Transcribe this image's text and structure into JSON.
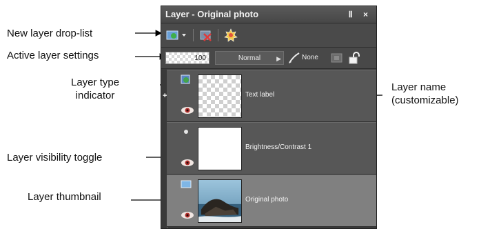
{
  "panel": {
    "title": "Layer - Original photo",
    "window_buttons": "Ⅱ ×",
    "opacity": "100",
    "blend_mode": "Normal",
    "blend_arrow": "▶",
    "brush_mode": "None"
  },
  "layers": [
    {
      "name": "Text label",
      "thumbnail": "transparent-checker"
    },
    {
      "name": "Brightness/Contrast 1",
      "thumbnail": "white"
    },
    {
      "name": "Original photo",
      "thumbnail": "photo"
    }
  ],
  "expand_symbol": "+",
  "callouts": {
    "new_layer": "New layer drop-list",
    "active_settings": "Active layer settings",
    "layer_type": "Layer type\nindicator",
    "visibility": "Layer visibility toggle",
    "thumbnail": "Layer thumbnail",
    "layer_name": "Layer name\n(customizable)"
  }
}
